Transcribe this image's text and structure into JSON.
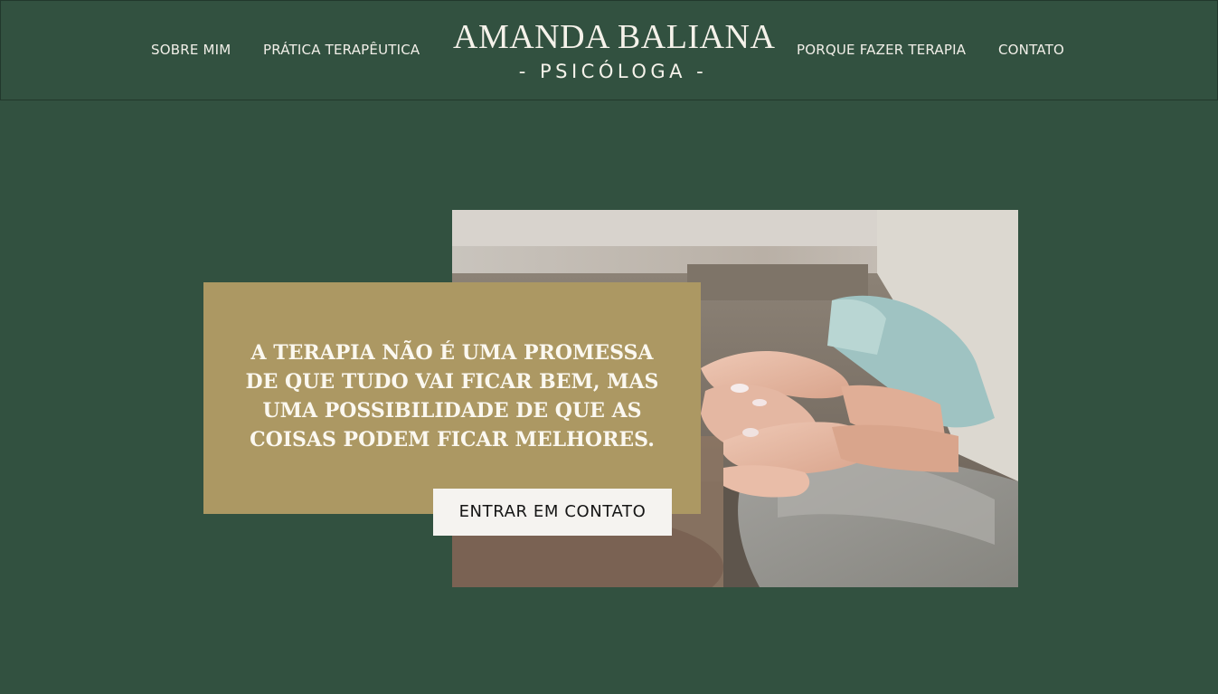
{
  "nav": {
    "left": [
      {
        "label": "SOBRE MIM"
      },
      {
        "label": "PRÁTICA TERAPÊUTICA"
      }
    ],
    "right": [
      {
        "label": "PORQUE FAZER TERAPIA"
      },
      {
        "label": "CONTATO"
      }
    ]
  },
  "brand": {
    "name": "AMANDA BALIANA",
    "subtitle": "- PSICÓLOGA -"
  },
  "hero": {
    "quote": "A TERAPIA NÃO É UMA PROMESSA DE QUE TUDO VAI FICAR BEM, MAS UMA POSSIBILIDADE DE QUE AS COISAS PODEM FICAR MELHORES.",
    "cta_label": "ENTRAR EM CONTATO"
  },
  "colors": {
    "background": "#325140",
    "quote_box": "#ac9863",
    "button": "#f5f3f0",
    "text_light": "#f1efe8"
  }
}
